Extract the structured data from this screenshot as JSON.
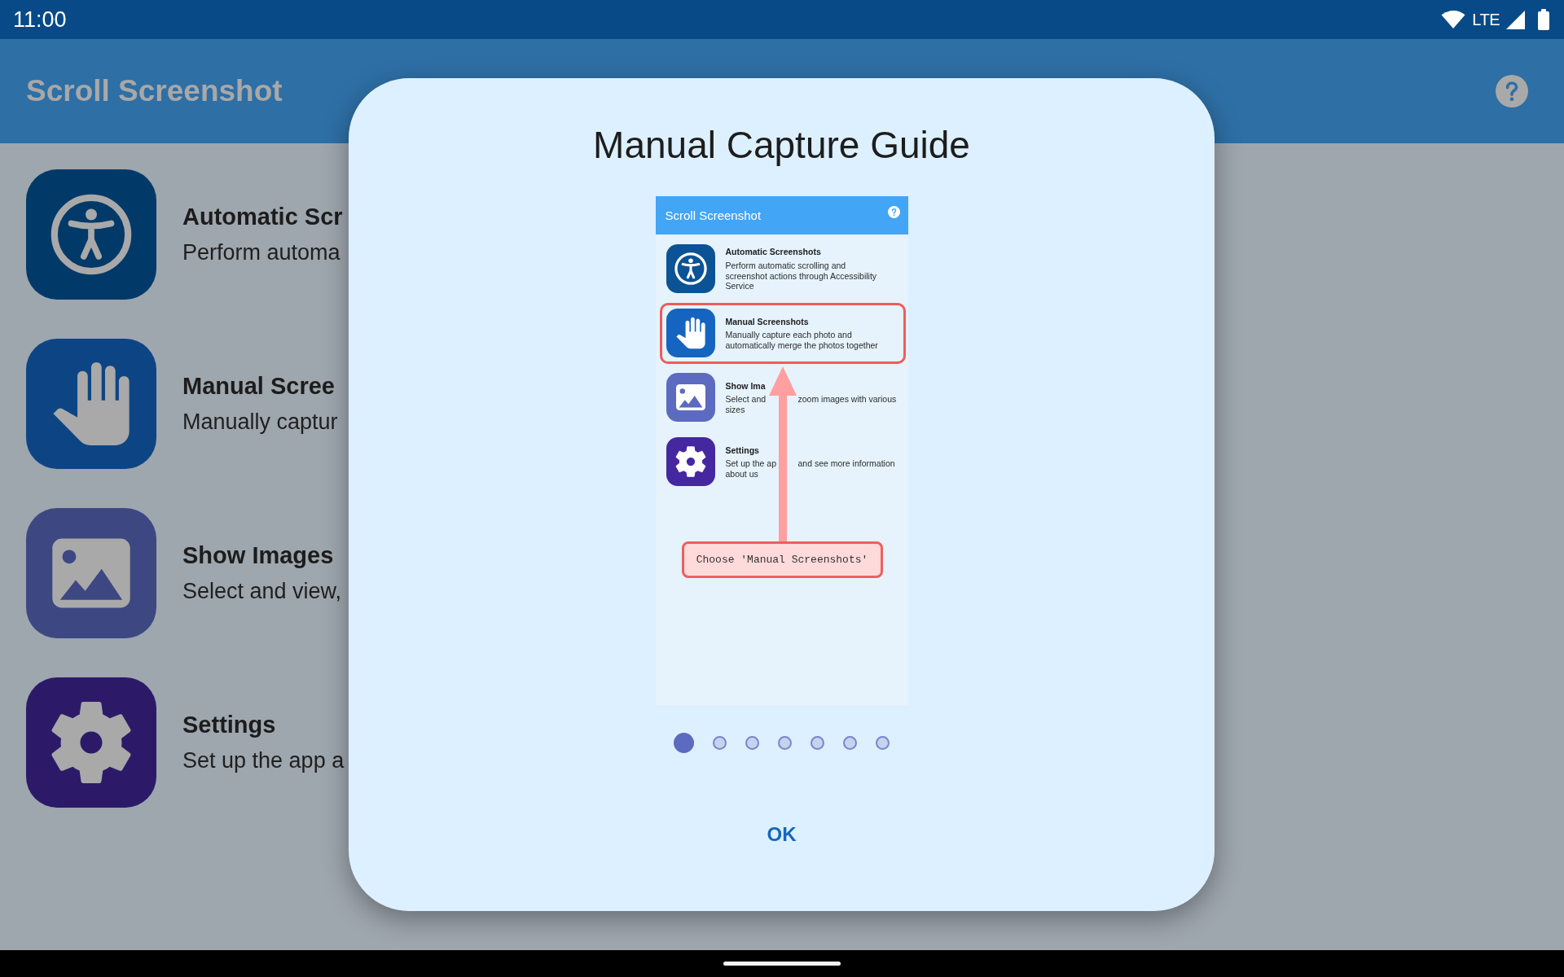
{
  "status_bar": {
    "time": "11:00",
    "network": "LTE"
  },
  "app_bar": {
    "title": "Scroll Screenshot"
  },
  "menu_items": [
    {
      "kind": "automatic",
      "color": "#013a68",
      "title": "Automatic Scr",
      "subtitle": "Perform automa"
    },
    {
      "kind": "manual",
      "color": "#0d4584",
      "title": "Manual Scree",
      "subtitle": "Manually captur"
    },
    {
      "kind": "images",
      "color": "#3d4882",
      "title": "Show Images",
      "subtitle": "Select and view,"
    },
    {
      "kind": "settings",
      "color": "#2c1a69",
      "title": "Settings",
      "subtitle": "Set up the app a"
    }
  ],
  "dialog": {
    "title": "Manual Capture Guide",
    "preview": {
      "app_bar": {
        "title": "Scroll Screenshot"
      },
      "menu_items": [
        {
          "kind": "automatic",
          "color": "#0b5394",
          "highlighted": false,
          "title": "Automatic Screenshots",
          "description_lines": [
            [
              "Perform automatic scrolling and"
            ],
            [
              "screenshot actions through Accessibility"
            ],
            [
              "Service"
            ]
          ]
        },
        {
          "kind": "manual",
          "color": "#1565c0",
          "highlighted": true,
          "title": "Manual Screenshots",
          "description_lines": [
            [
              "Manually capture each photo and"
            ],
            [
              "automatically merge the photos together"
            ]
          ]
        },
        {
          "kind": "images",
          "color": "#5c6bc0",
          "highlighted": false,
          "title": "Show Ima",
          "description_lines": [
            [
              "Select and",
              "zoom images with various"
            ],
            [
              "sizes"
            ]
          ]
        },
        {
          "kind": "settings",
          "color": "#4527a0",
          "highlighted": false,
          "title": "Settings",
          "description_lines": [
            [
              "Set up the ap",
              "and see more information"
            ],
            [
              "about us"
            ]
          ]
        }
      ],
      "callout": "Choose 'Manual Screenshots'"
    },
    "pages": [
      {
        "selected": true
      },
      {
        "selected": false
      },
      {
        "selected": false
      },
      {
        "selected": false
      },
      {
        "selected": false
      },
      {
        "selected": false
      },
      {
        "selected": false
      }
    ],
    "button": "OK"
  }
}
